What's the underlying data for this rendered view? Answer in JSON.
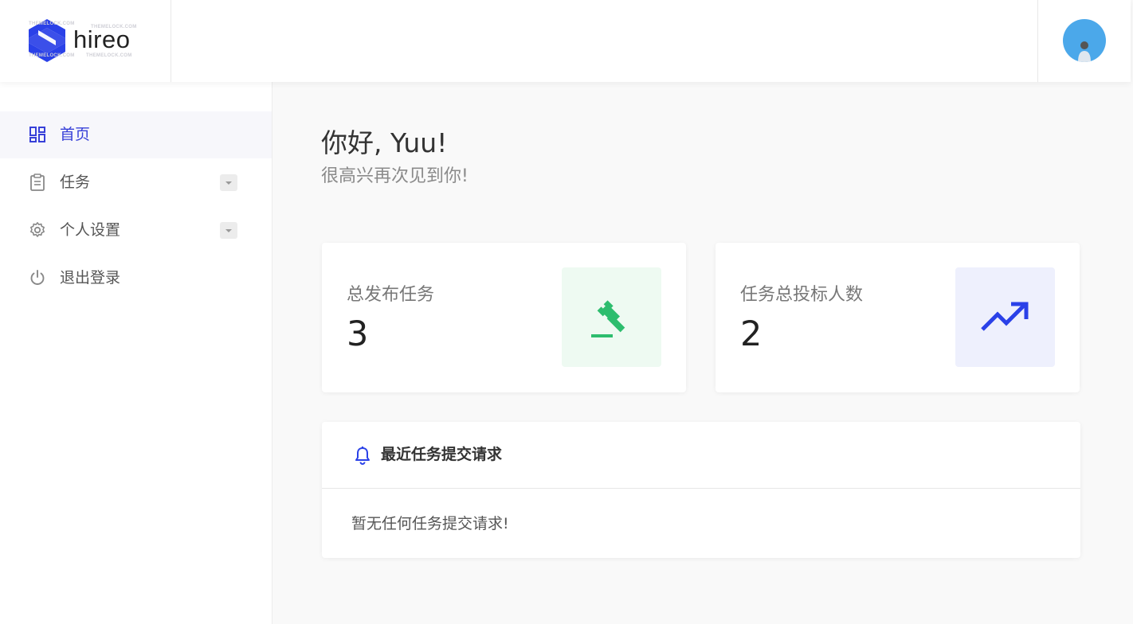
{
  "brand": {
    "name": "hireo",
    "watermark": "THEMELOCK.COM"
  },
  "sidebar": {
    "items": [
      {
        "label": "首页",
        "icon": "dashboard-grid-icon",
        "active": true
      },
      {
        "label": "任务",
        "icon": "clipboard-icon",
        "has_dropdown": true
      },
      {
        "label": "个人设置",
        "icon": "gear-icon",
        "has_dropdown": true
      },
      {
        "label": "退出登录",
        "icon": "power-icon"
      }
    ]
  },
  "main": {
    "greeting": "你好, Yuu!",
    "subgreeting": "很高兴再次见到你!",
    "stats": [
      {
        "label": "总发布任务",
        "value": "3",
        "icon": "gavel-icon",
        "icon_color": "#2dbd6e",
        "icon_bg": "#eefaf2"
      },
      {
        "label": "任务总投标人数",
        "value": "2",
        "icon": "trending-up-icon",
        "icon_color": "#2a41e8",
        "icon_bg": "#eef0fd"
      }
    ],
    "requests": {
      "title": "最近任务提交请求",
      "empty_text": "暂无任何任务提交请求!"
    }
  },
  "colors": {
    "accent": "#2a41e8",
    "active_text": "#3740d8",
    "avatar_bg": "#4ba8ea"
  }
}
